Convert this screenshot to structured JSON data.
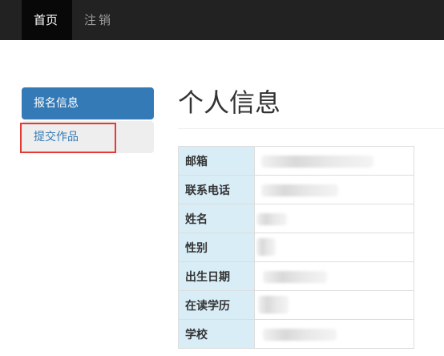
{
  "navbar": {
    "home_label": "首页",
    "logout_label": "注销"
  },
  "sidebar": {
    "items": [
      {
        "label": "报名信息",
        "active": true
      },
      {
        "label": "提交作品",
        "active": false
      }
    ]
  },
  "main": {
    "title": "个人信息",
    "fields": [
      {
        "label": "邮箱"
      },
      {
        "label": "联系电话"
      },
      {
        "label": "姓名"
      },
      {
        "label": "性别"
      },
      {
        "label": "出生日期"
      },
      {
        "label": "在读学历"
      },
      {
        "label": "学校"
      }
    ]
  },
  "colors": {
    "navbar_bg": "#222222",
    "active_item": "#337ab7",
    "label_cell_bg": "#d9edf7",
    "highlight_border": "#e53935"
  }
}
